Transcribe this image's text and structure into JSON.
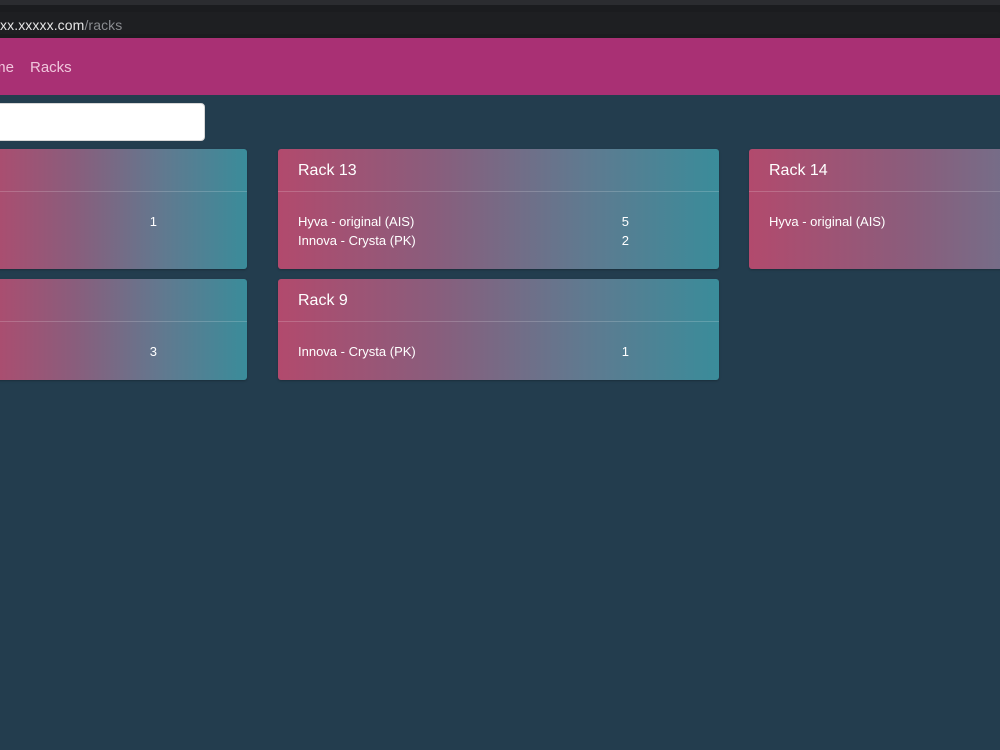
{
  "browser": {
    "url_host": "xx.xxxxx.com",
    "url_path": "/racks"
  },
  "nav": {
    "home_label": "Home",
    "racks_label": "Racks"
  },
  "search": {
    "value": "",
    "placeholder": ""
  },
  "cards": [
    {
      "title": "",
      "items": [
        {
          "name": "",
          "qty": "1"
        }
      ]
    },
    {
      "title": "Rack 13",
      "items": [
        {
          "name": "Hyva - original (AIS)",
          "qty": "5"
        },
        {
          "name": "Innova - Crysta (PK)",
          "qty": "2"
        }
      ]
    },
    {
      "title": "Rack 14",
      "items": [
        {
          "name": "Hyva - original (AIS)",
          "qty": ""
        }
      ]
    },
    {
      "title": "",
      "items": [
        {
          "name": "",
          "qty": "3"
        }
      ]
    },
    {
      "title": "Rack 9",
      "items": [
        {
          "name": "Innova - Crysta (PK)",
          "qty": "1"
        }
      ]
    }
  ],
  "colors": {
    "page_background": "#233d4e",
    "navbar": "#a93074",
    "card_gradient_start": "#b24a6d",
    "card_gradient_end": "#3a8c9a"
  }
}
